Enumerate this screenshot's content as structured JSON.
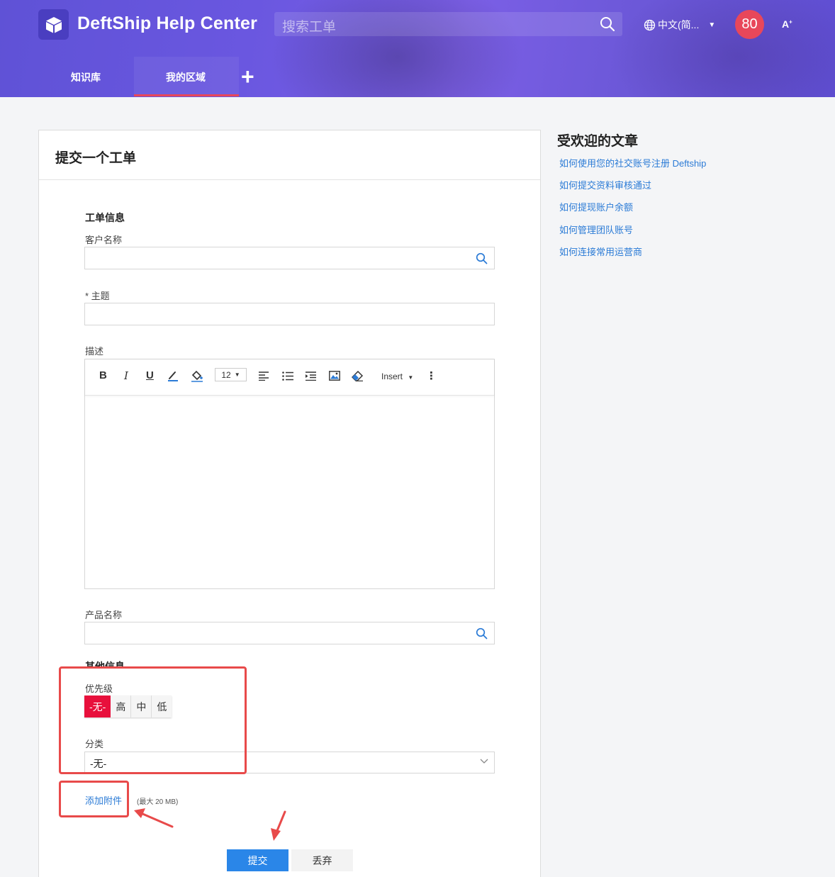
{
  "header": {
    "brand": "DeftShip Help Center",
    "search_placeholder": "搜索工单",
    "language": "中文(简...",
    "avatar_text": "80",
    "font_label": "A"
  },
  "tabs": [
    {
      "label": "知识库"
    },
    {
      "label": "我的区域"
    },
    {
      "label": "+"
    }
  ],
  "form": {
    "title": "提交一个工单",
    "section_ticket": "工单信息",
    "customer_label": "客户名称",
    "subject_label": "* 主题",
    "description_label": "描述",
    "toolbar": {
      "bold": "B",
      "italic": "I",
      "underline": "U",
      "font_size": "12",
      "insert": "Insert",
      "more": "⋮"
    },
    "product_label": "产品名称",
    "section_other": "其他信息",
    "priority_label": "优先级",
    "priority_options": [
      "-无-",
      "高",
      "中",
      "低"
    ],
    "category_label": "分类",
    "category_value": "-无-",
    "attach_label": "添加附件",
    "attach_note": "(最大 20 MB)",
    "submit_label": "提交",
    "discard_label": "丢弃"
  },
  "sidebar": {
    "title": "受欢迎的文章",
    "links": [
      "如何使用您的社交账号注册 Deftship",
      "如何提交资料审核通过",
      "如何提现账户余额",
      "如何管理团队账号",
      "如何连接常用运营商"
    ]
  },
  "colors": {
    "accent": "#2a86e8",
    "priority_active": "#e8103c",
    "annotation": "#e84a4a",
    "header_purple": "#6a57e0"
  }
}
